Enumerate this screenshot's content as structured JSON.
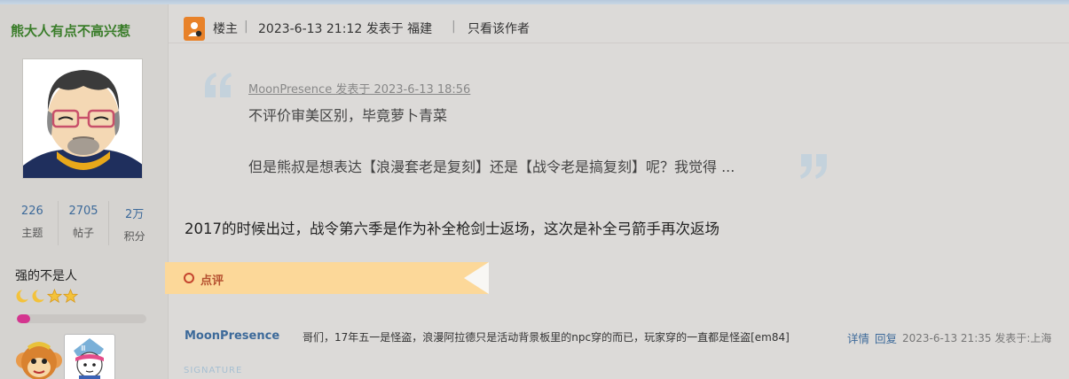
{
  "author": {
    "name": "熊大人有点不高兴惹",
    "stats": [
      {
        "value": "226",
        "label": "主题"
      },
      {
        "value": "2705",
        "label": "帖子"
      },
      {
        "value": "2万",
        "label": "积分"
      }
    ],
    "title": "强的不是人",
    "level_progress": 0.1
  },
  "header": {
    "op_label": "楼主",
    "post_time": "2023-6-13 21:12 发表于 福建",
    "only_author_link": "只看该作者"
  },
  "quote": {
    "meta": "MoonPresence 发表于 2023-6-13 18:56",
    "line1": "不评价审美区别，毕竟萝卜青菜",
    "line2": "但是熊叔是想表达【浪漫套老是复刻】还是【战令老是搞复刻】呢？我觉得 ..."
  },
  "body": "2017的时候出过，战令第六季是作为补全枪剑士返场，这次是补全弓箭手再次返场",
  "comment_section": {
    "label": "点评",
    "comments": [
      {
        "author": "MoonPresence",
        "text": "哥们，17年五一是怪盗，浪漫阿拉德只是活动背景板里的npc穿的而已，玩家穿的一直都是怪盗[em84]",
        "detail_link": "详情",
        "reply_link": "回复",
        "time": "2023-6-13 21:35 发表于:上海"
      }
    ]
  },
  "signature_label": "SIGNATURE",
  "colors": {
    "author_name": "#3a7d2a",
    "link_blue": "#3d6a9a",
    "comment_banner": "#fcd899",
    "progress_fill": "#d4358f"
  },
  "icons": [
    "op-icon",
    "moon-icon",
    "star-icon",
    "quote-open-icon",
    "quote-close-icon",
    "comment-ring-icon"
  ]
}
